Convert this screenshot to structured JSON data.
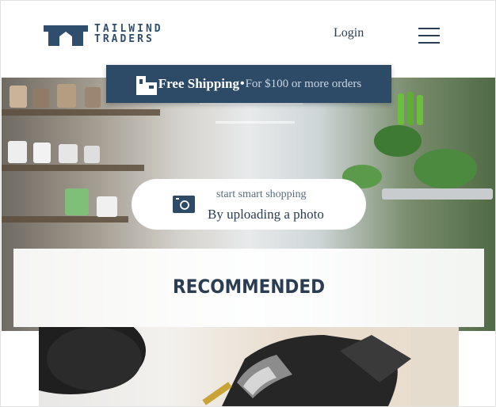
{
  "header": {
    "logo_line1": "TAILWIND",
    "logo_line2": "TRADERS",
    "login_label": "Login",
    "menu_icon": "hamburger-menu-icon"
  },
  "shipping_banner": {
    "icon": "shipping-boxes-icon",
    "highlight": "Free Shipping",
    "separator": "•",
    "detail": "For $100 or more orders"
  },
  "upload": {
    "icon": "camera-icon",
    "subtitle": "start smart shopping",
    "title": "By uploading a photo"
  },
  "recommended": {
    "heading": "RECOMMENDED"
  },
  "colors": {
    "brand_navy": "#2d4a66",
    "text_dark": "#2a3d52",
    "logo_blue": "#2f4e6e"
  }
}
